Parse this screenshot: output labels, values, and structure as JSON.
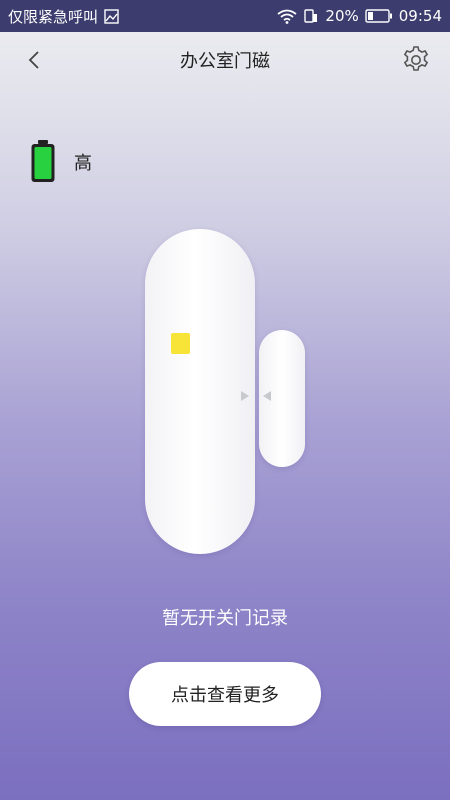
{
  "status_bar": {
    "carrier": "仅限紧急呼叫",
    "battery_percent": "20%",
    "time": "09:54",
    "icons": [
      "image-icon",
      "wifi-icon",
      "sim-icon",
      "battery-icon"
    ]
  },
  "header": {
    "title": "办公室门磁",
    "back_icon": "chevron-left-icon",
    "settings_icon": "gear-icon"
  },
  "battery": {
    "label": "高",
    "icon": "battery-full-icon",
    "color": "#27d13f"
  },
  "sensor": {
    "led_color": "#f7e436"
  },
  "record": {
    "text": "暂无开关门记录"
  },
  "more_button": {
    "label": "点击查看更多"
  },
  "colors": {
    "status_bar_bg": "#3c3d6e",
    "gradient_top": "#eeeef2",
    "gradient_bottom": "#7b6fbf"
  }
}
